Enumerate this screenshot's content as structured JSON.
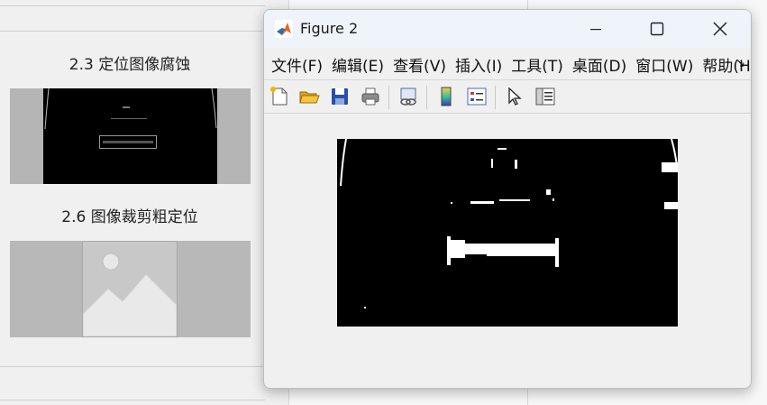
{
  "background": {
    "captions": [
      "2.3 定位图像腐蚀",
      "2.6 图像裁剪粗定位"
    ]
  },
  "figure": {
    "title": "Figure 2",
    "menu": [
      "文件(F)",
      "编辑(E)",
      "查看(V)",
      "插入(I)",
      "工具(T)",
      "桌面(D)",
      "窗口(W)",
      "帮助(H)"
    ],
    "toolbar": [
      "new-figure-icon",
      "open-file-icon",
      "save-icon",
      "print-icon",
      "link-plot-icon",
      "colorbar-icon",
      "legend-icon",
      "pointer-icon",
      "property-editor-icon"
    ],
    "window_buttons": [
      "minimize",
      "maximize",
      "close"
    ]
  }
}
